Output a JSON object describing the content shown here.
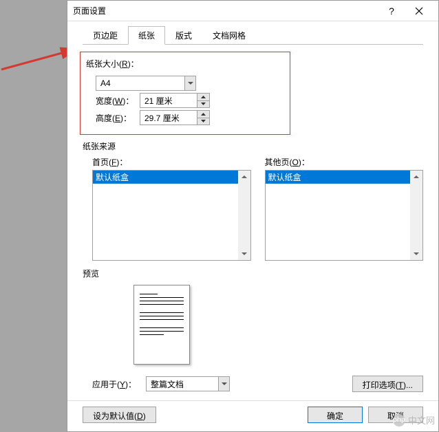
{
  "dialog": {
    "title": "页面设置",
    "help_symbol": "?",
    "tabs": [
      "页边距",
      "纸张",
      "版式",
      "文档网格"
    ],
    "active_tab_index": 1
  },
  "paper_size": {
    "section_label": "纸张大小",
    "section_key": "R",
    "value": "A4",
    "width_label": "宽度",
    "width_key": "W",
    "width_value": "21 厘米",
    "height_label": "高度",
    "height_key": "E",
    "height_value": "29.7 厘米"
  },
  "paper_source": {
    "section_label": "纸张来源",
    "first_page_label": "首页",
    "first_page_key": "F",
    "first_page_items": [
      "默认纸盒"
    ],
    "other_pages_label": "其他页",
    "other_pages_key": "O",
    "other_pages_items": [
      "默认纸盒"
    ]
  },
  "preview": {
    "label": "预览"
  },
  "apply": {
    "label": "应用于",
    "key": "Y",
    "value": "整篇文档"
  },
  "print_options": {
    "label": "打印选项",
    "key": "T"
  },
  "footer": {
    "default_label": "设为默认值",
    "default_key": "D",
    "ok": "确定",
    "cancel": "取消"
  },
  "watermark": "中文网"
}
